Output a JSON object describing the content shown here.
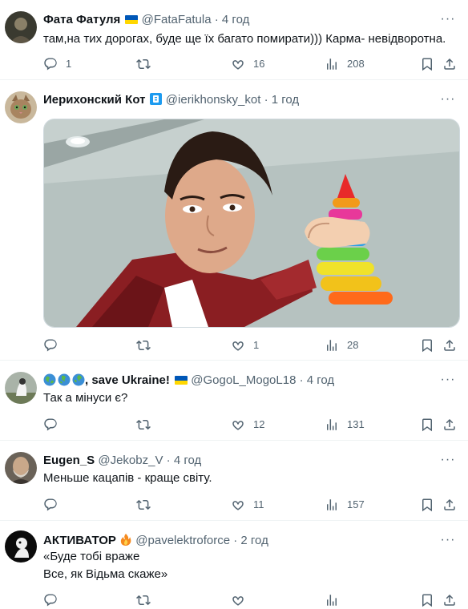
{
  "tweets": [
    {
      "name": "Фата Фатуля",
      "handle": "@FataFatula",
      "time": "4 год",
      "text": [
        "там,на тих дорогах, буде ще їх багато помирати))) Карма- невідворотна."
      ],
      "replies": "1",
      "retweets": "",
      "likes": "16",
      "views": "208"
    },
    {
      "name": "Иерихонский Кот",
      "handle": "@ierikhonsky_kot",
      "time": "1 год",
      "text": [],
      "replies": "",
      "retweets": "",
      "likes": "1",
      "views": "28"
    },
    {
      "name": ", save Ukraine!",
      "handle": "@GogoL_MogoL18",
      "time": "4 год",
      "text": [
        "Так а мінуси є?"
      ],
      "replies": "",
      "retweets": "",
      "likes": "12",
      "views": "131"
    },
    {
      "name": "Eugen_S",
      "handle": "@Jekobz_V",
      "time": "4 год",
      "text": [
        "Меньше кацапів - краще світу."
      ],
      "replies": "",
      "retweets": "",
      "likes": "11",
      "views": "157"
    },
    {
      "name": "АКТИВАТОР",
      "handle": "@pavelektroforce",
      "time": "2 год",
      "text": [
        "«Буде тобі враже",
        "Все, як Відьма скаже»"
      ],
      "replies": "",
      "retweets": "",
      "likes": "",
      "views": ""
    }
  ],
  "ui": {
    "separator": "·",
    "more": "···"
  },
  "icons": {
    "reply": "reply-icon",
    "retweet": "retweet-icon",
    "like": "heart-icon",
    "views": "views-icon",
    "bookmark": "bookmark-icon",
    "share": "share-icon"
  },
  "colors": {
    "text": "#0f1419",
    "muted": "#536471",
    "border": "#eff3f4"
  }
}
